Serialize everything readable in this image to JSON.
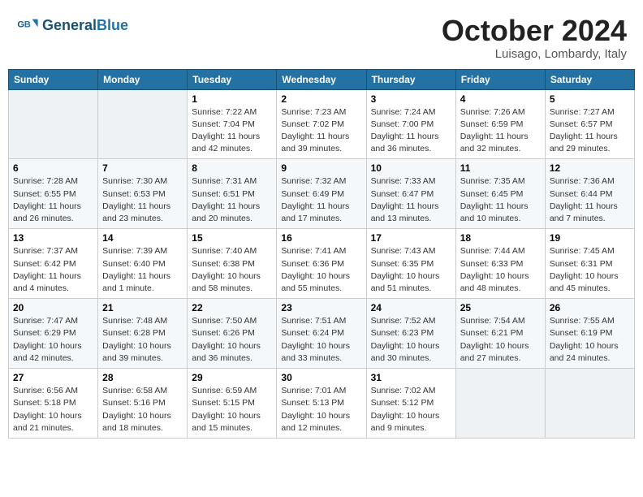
{
  "header": {
    "logo_general": "General",
    "logo_blue": "Blue",
    "month_title": "October 2024",
    "subtitle": "Luisago, Lombardy, Italy"
  },
  "weekdays": [
    "Sunday",
    "Monday",
    "Tuesday",
    "Wednesday",
    "Thursday",
    "Friday",
    "Saturday"
  ],
  "weeks": [
    [
      {
        "day": null
      },
      {
        "day": null
      },
      {
        "day": "1",
        "sunrise": "Sunrise: 7:22 AM",
        "sunset": "Sunset: 7:04 PM",
        "daylight": "Daylight: 11 hours and 42 minutes."
      },
      {
        "day": "2",
        "sunrise": "Sunrise: 7:23 AM",
        "sunset": "Sunset: 7:02 PM",
        "daylight": "Daylight: 11 hours and 39 minutes."
      },
      {
        "day": "3",
        "sunrise": "Sunrise: 7:24 AM",
        "sunset": "Sunset: 7:00 PM",
        "daylight": "Daylight: 11 hours and 36 minutes."
      },
      {
        "day": "4",
        "sunrise": "Sunrise: 7:26 AM",
        "sunset": "Sunset: 6:59 PM",
        "daylight": "Daylight: 11 hours and 32 minutes."
      },
      {
        "day": "5",
        "sunrise": "Sunrise: 7:27 AM",
        "sunset": "Sunset: 6:57 PM",
        "daylight": "Daylight: 11 hours and 29 minutes."
      }
    ],
    [
      {
        "day": "6",
        "sunrise": "Sunrise: 7:28 AM",
        "sunset": "Sunset: 6:55 PM",
        "daylight": "Daylight: 11 hours and 26 minutes."
      },
      {
        "day": "7",
        "sunrise": "Sunrise: 7:30 AM",
        "sunset": "Sunset: 6:53 PM",
        "daylight": "Daylight: 11 hours and 23 minutes."
      },
      {
        "day": "8",
        "sunrise": "Sunrise: 7:31 AM",
        "sunset": "Sunset: 6:51 PM",
        "daylight": "Daylight: 11 hours and 20 minutes."
      },
      {
        "day": "9",
        "sunrise": "Sunrise: 7:32 AM",
        "sunset": "Sunset: 6:49 PM",
        "daylight": "Daylight: 11 hours and 17 minutes."
      },
      {
        "day": "10",
        "sunrise": "Sunrise: 7:33 AM",
        "sunset": "Sunset: 6:47 PM",
        "daylight": "Daylight: 11 hours and 13 minutes."
      },
      {
        "day": "11",
        "sunrise": "Sunrise: 7:35 AM",
        "sunset": "Sunset: 6:45 PM",
        "daylight": "Daylight: 11 hours and 10 minutes."
      },
      {
        "day": "12",
        "sunrise": "Sunrise: 7:36 AM",
        "sunset": "Sunset: 6:44 PM",
        "daylight": "Daylight: 11 hours and 7 minutes."
      }
    ],
    [
      {
        "day": "13",
        "sunrise": "Sunrise: 7:37 AM",
        "sunset": "Sunset: 6:42 PM",
        "daylight": "Daylight: 11 hours and 4 minutes."
      },
      {
        "day": "14",
        "sunrise": "Sunrise: 7:39 AM",
        "sunset": "Sunset: 6:40 PM",
        "daylight": "Daylight: 11 hours and 1 minute."
      },
      {
        "day": "15",
        "sunrise": "Sunrise: 7:40 AM",
        "sunset": "Sunset: 6:38 PM",
        "daylight": "Daylight: 10 hours and 58 minutes."
      },
      {
        "day": "16",
        "sunrise": "Sunrise: 7:41 AM",
        "sunset": "Sunset: 6:36 PM",
        "daylight": "Daylight: 10 hours and 55 minutes."
      },
      {
        "day": "17",
        "sunrise": "Sunrise: 7:43 AM",
        "sunset": "Sunset: 6:35 PM",
        "daylight": "Daylight: 10 hours and 51 minutes."
      },
      {
        "day": "18",
        "sunrise": "Sunrise: 7:44 AM",
        "sunset": "Sunset: 6:33 PM",
        "daylight": "Daylight: 10 hours and 48 minutes."
      },
      {
        "day": "19",
        "sunrise": "Sunrise: 7:45 AM",
        "sunset": "Sunset: 6:31 PM",
        "daylight": "Daylight: 10 hours and 45 minutes."
      }
    ],
    [
      {
        "day": "20",
        "sunrise": "Sunrise: 7:47 AM",
        "sunset": "Sunset: 6:29 PM",
        "daylight": "Daylight: 10 hours and 42 minutes."
      },
      {
        "day": "21",
        "sunrise": "Sunrise: 7:48 AM",
        "sunset": "Sunset: 6:28 PM",
        "daylight": "Daylight: 10 hours and 39 minutes."
      },
      {
        "day": "22",
        "sunrise": "Sunrise: 7:50 AM",
        "sunset": "Sunset: 6:26 PM",
        "daylight": "Daylight: 10 hours and 36 minutes."
      },
      {
        "day": "23",
        "sunrise": "Sunrise: 7:51 AM",
        "sunset": "Sunset: 6:24 PM",
        "daylight": "Daylight: 10 hours and 33 minutes."
      },
      {
        "day": "24",
        "sunrise": "Sunrise: 7:52 AM",
        "sunset": "Sunset: 6:23 PM",
        "daylight": "Daylight: 10 hours and 30 minutes."
      },
      {
        "day": "25",
        "sunrise": "Sunrise: 7:54 AM",
        "sunset": "Sunset: 6:21 PM",
        "daylight": "Daylight: 10 hours and 27 minutes."
      },
      {
        "day": "26",
        "sunrise": "Sunrise: 7:55 AM",
        "sunset": "Sunset: 6:19 PM",
        "daylight": "Daylight: 10 hours and 24 minutes."
      }
    ],
    [
      {
        "day": "27",
        "sunrise": "Sunrise: 6:56 AM",
        "sunset": "Sunset: 5:18 PM",
        "daylight": "Daylight: 10 hours and 21 minutes."
      },
      {
        "day": "28",
        "sunrise": "Sunrise: 6:58 AM",
        "sunset": "Sunset: 5:16 PM",
        "daylight": "Daylight: 10 hours and 18 minutes."
      },
      {
        "day": "29",
        "sunrise": "Sunrise: 6:59 AM",
        "sunset": "Sunset: 5:15 PM",
        "daylight": "Daylight: 10 hours and 15 minutes."
      },
      {
        "day": "30",
        "sunrise": "Sunrise: 7:01 AM",
        "sunset": "Sunset: 5:13 PM",
        "daylight": "Daylight: 10 hours and 12 minutes."
      },
      {
        "day": "31",
        "sunrise": "Sunrise: 7:02 AM",
        "sunset": "Sunset: 5:12 PM",
        "daylight": "Daylight: 10 hours and 9 minutes."
      },
      {
        "day": null
      },
      {
        "day": null
      }
    ]
  ]
}
